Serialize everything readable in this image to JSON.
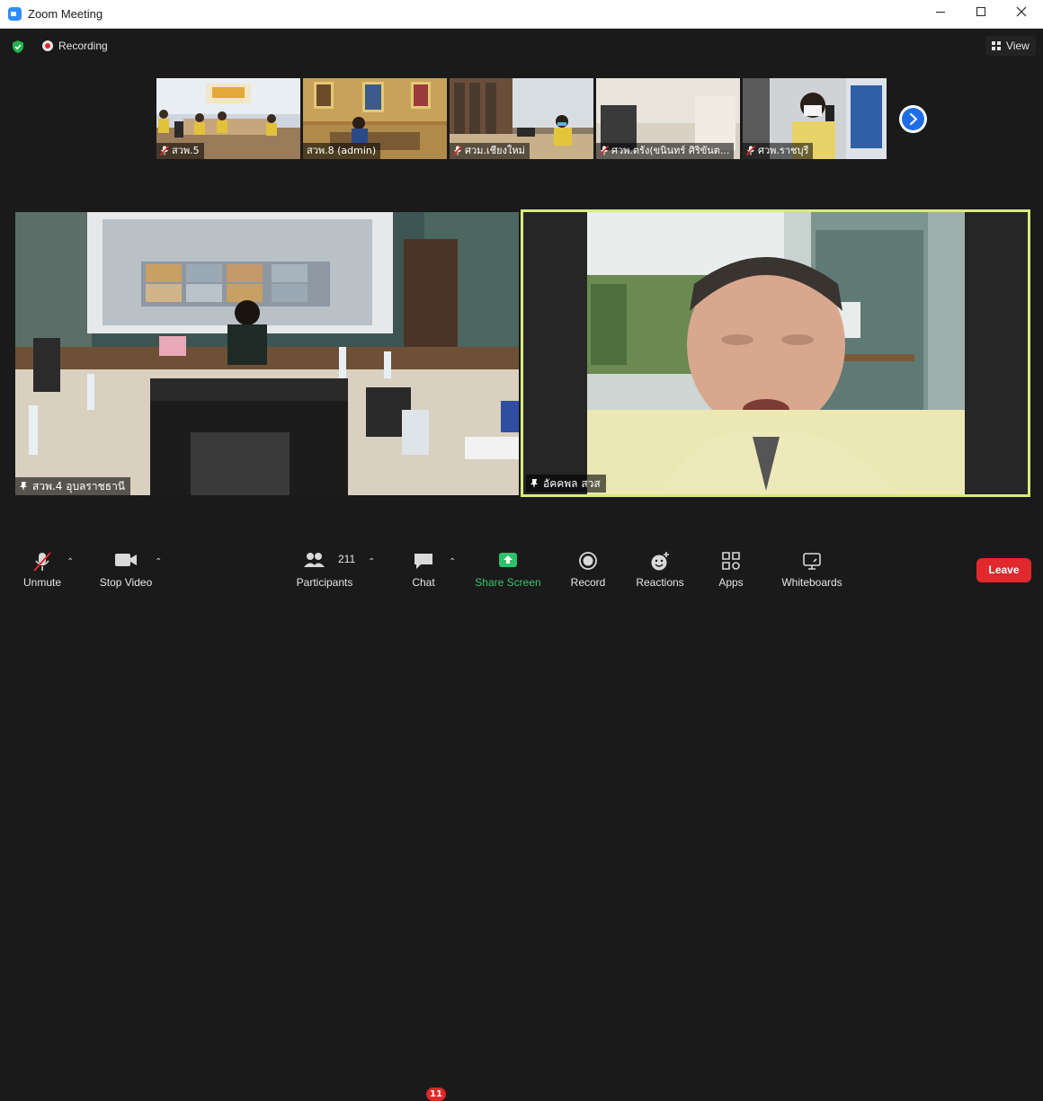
{
  "window": {
    "title": "Zoom Meeting",
    "controls": [
      "minimize-icon",
      "maximize-icon",
      "close-icon"
    ]
  },
  "status": {
    "recording_label": "Recording",
    "security_icon": "shield-check-icon"
  },
  "view_button": {
    "label": "View",
    "icon": "grid-icon"
  },
  "gallery_strip": {
    "participants": [
      {
        "name": "สวพ.5",
        "muted": true
      },
      {
        "name": "สวพ.8 (admin)",
        "muted": false
      },
      {
        "name": "ศวม.เชียงใหม่",
        "muted": true
      },
      {
        "name": "ศวพ.ตรัง(ขนินทร์ ศิริขันต...",
        "muted": true
      },
      {
        "name": "ศวพ.ราชบุรี",
        "muted": true
      }
    ],
    "next_icon": "chevron-right-icon"
  },
  "main_tiles": [
    {
      "name": "สวพ.4 อุบลราชธานี",
      "pinned": true,
      "active": false
    },
    {
      "name": "อัคคพล สวส",
      "pinned": true,
      "active": true
    }
  ],
  "toolbar": {
    "unmute": {
      "label": "Unmute",
      "icon": "mic-muted-icon"
    },
    "video": {
      "label": "Stop Video",
      "icon": "video-camera-icon"
    },
    "participants": {
      "label": "Participants",
      "count": "211",
      "icon": "people-icon"
    },
    "chat": {
      "label": "Chat",
      "badge": "11",
      "icon": "chat-bubble-icon"
    },
    "share": {
      "label": "Share Screen",
      "icon": "share-arrow-icon",
      "color": "#2ec16b"
    },
    "record": {
      "label": "Record",
      "icon": "record-icon"
    },
    "reactions": {
      "label": "Reactions",
      "icon": "smiley-plus-icon"
    },
    "apps": {
      "label": "Apps",
      "icon": "apps-icon"
    },
    "whiteboards": {
      "label": "Whiteboards",
      "icon": "whiteboard-icon"
    },
    "leave": {
      "label": "Leave",
      "color": "#e0282d"
    }
  },
  "colors": {
    "active_speaker_border": "#d7ec7a",
    "accent_blue": "#1f6de6"
  }
}
